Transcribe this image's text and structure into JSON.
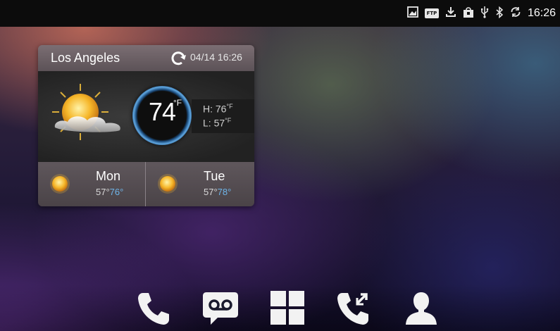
{
  "status_bar": {
    "time": "16:26",
    "icons": [
      "image-icon",
      "ftp-icon",
      "download-icon",
      "store-bag-icon",
      "usb-icon",
      "bluetooth-icon",
      "sync-icon"
    ],
    "ftp_label": "FTP"
  },
  "weather": {
    "city": "Los Angeles",
    "updated": "04/14 16:26",
    "condition_icon": "partly-cloudy-icon",
    "current_temp": "74",
    "unit": "°F",
    "high_label": "H:",
    "high": "76",
    "low_label": "L:",
    "low": "57",
    "forecast": [
      {
        "day": "Mon",
        "low": "57°",
        "high": "76°",
        "icon": "sunny-icon"
      },
      {
        "day": "Tue",
        "low": "57°",
        "high": "78°",
        "icon": "sunny-icon"
      }
    ],
    "colors": {
      "high_temp": "#6eb4e8",
      "dial_ring": "#5fa6e0"
    }
  },
  "dock": {
    "items": [
      "phone-icon",
      "voicemail-icon",
      "apps-grid-icon",
      "call-forward-icon",
      "contacts-icon"
    ]
  }
}
